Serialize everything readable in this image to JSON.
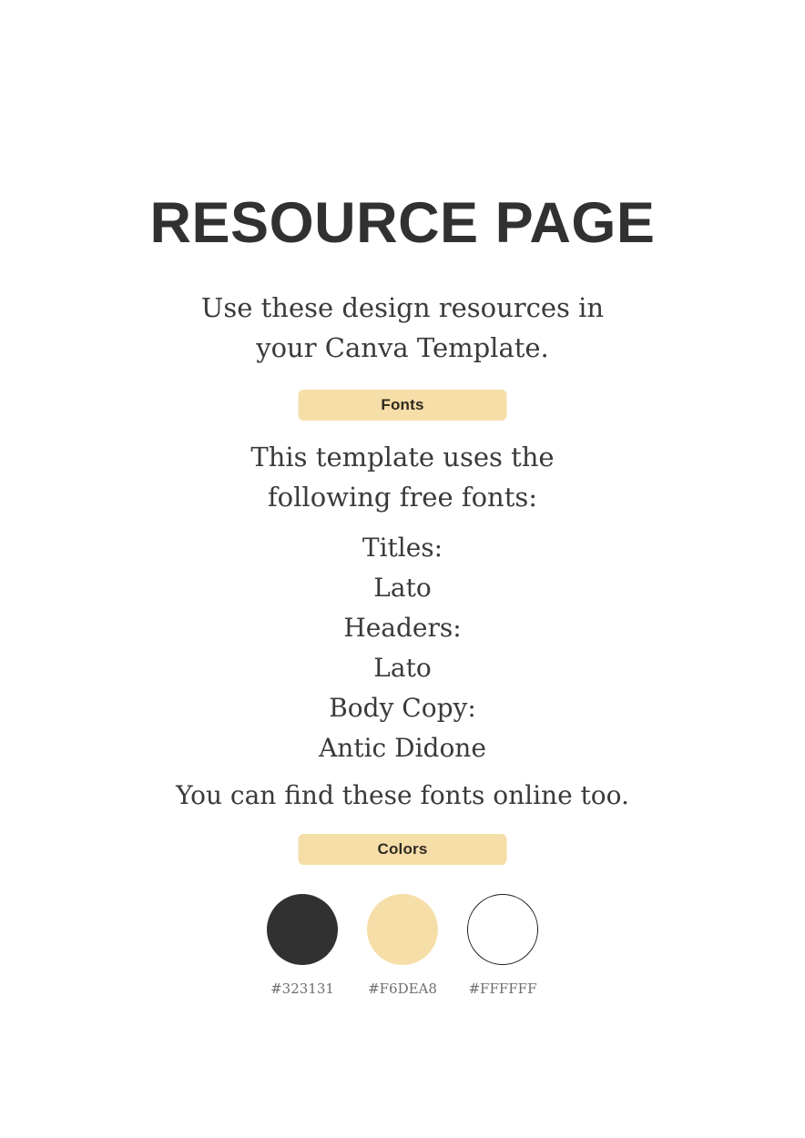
{
  "document": {
    "title": "RESOURCE PAGE",
    "background_color": "#FFFFFF"
  },
  "intro": {
    "line1": "Use these design resources in",
    "line2": "your Canva Template."
  },
  "sections": {
    "fonts_badge_label": "Fonts",
    "colors_badge_label": "Colors",
    "badge_background": "#F6DEA8",
    "badge_text_color": "#2F2A22"
  },
  "fonts": {
    "intro_line1": "This template uses the",
    "intro_line2": "following free fonts:",
    "titles_label": "Titles:",
    "titles_font": "Lato",
    "headers_label": "Headers:",
    "headers_font": "Lato",
    "body_label": "Body Copy:",
    "body_font": "Antic Didone",
    "closing": "You can find these fonts online too."
  },
  "colors": {
    "swatches": [
      {
        "name": "charcoal",
        "hex": "#323131",
        "label": "#323131",
        "outlined": false
      },
      {
        "name": "tan",
        "hex": "#F6DEA8",
        "label": "#F6DEA8",
        "outlined": false
      },
      {
        "name": "white",
        "hex": "#FFFFFF",
        "label": "#FFFFFF",
        "outlined": true
      }
    ]
  }
}
